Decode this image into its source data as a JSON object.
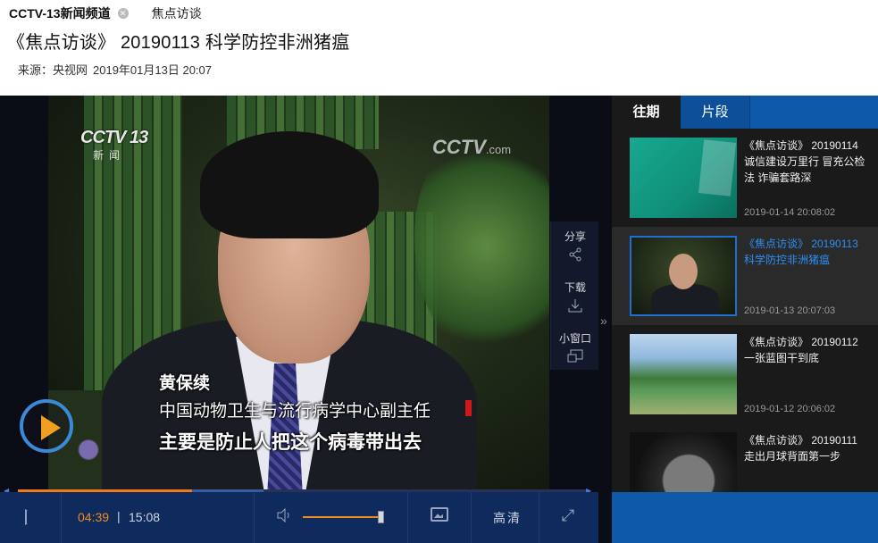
{
  "header": {
    "channel": "CCTV-13新闻频道",
    "close_icon": "close-icon",
    "column": "焦点访谈",
    "title": "《焦点访谈》 20190113 科学防控非洲猪瘟",
    "source_label": "来源：央视网",
    "datetime": "2019年01月13日 20:07"
  },
  "video": {
    "logo": "CCTV 13",
    "logo_sub": "新闻",
    "watermark": "CCTV",
    "watermark_suffix": ".com",
    "caption_name": "黄保续",
    "caption_role": "中国动物卫生与流行病学中心副主任",
    "subtitle": "主要是防止人把这个病毒带出去"
  },
  "actions": {
    "share": "分享",
    "download": "下载",
    "mini": "小窗口"
  },
  "controls": {
    "current_time": "04:39",
    "separator": "|",
    "total_time": "15:08",
    "quality": "高清",
    "progress_played": 0.305,
    "progress_buffered": 0.43,
    "volume": 0.95
  },
  "sidebar": {
    "tabs": [
      "往期",
      "片段"
    ],
    "items": [
      {
        "title": "《焦点访谈》 20190114 诚信建设万里行 冒充公检法 诈骗套路深",
        "date": "2019-01-14 20:08:02",
        "selected": false
      },
      {
        "title": "《焦点访谈》 20190113 科学防控非洲猪瘟",
        "date": "2019-01-13 20:07:03",
        "selected": true
      },
      {
        "title": "《焦点访谈》 20190112 一张蓝图干到底",
        "date": "2019-01-12 20:06:02",
        "selected": false
      },
      {
        "title": "《焦点访谈》 20190111 走出月球背面第一步",
        "date": "",
        "selected": false
      }
    ]
  },
  "colors": {
    "accent_orange": "#f08a20",
    "brand_blue": "#0e5aa8",
    "selected_blue": "#2d8ff0"
  }
}
